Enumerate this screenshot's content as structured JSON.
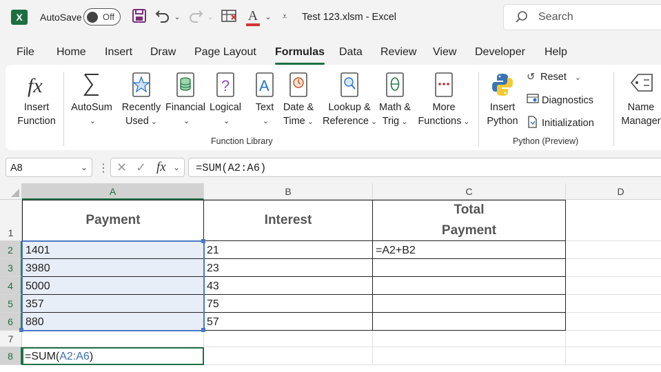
{
  "title_bar": {
    "app_logo": "X",
    "autosave_label": "AutoSave",
    "autosave_state": "Off",
    "document_title": "Test 123.xlsm  -  Excel",
    "search_placeholder": "Search"
  },
  "menu_tabs": [
    "File",
    "Home",
    "Insert",
    "Draw",
    "Page Layout",
    "Formulas",
    "Data",
    "Review",
    "View",
    "Developer",
    "Help"
  ],
  "active_tab": "Formulas",
  "ribbon": {
    "insert_function": [
      "Insert",
      "Function"
    ],
    "autosum": "AutoSum",
    "recently_used": [
      "Recently",
      "Used"
    ],
    "financial": "Financial",
    "logical": "Logical",
    "text": "Text",
    "date_time": [
      "Date &",
      "Time"
    ],
    "lookup_reference": [
      "Lookup &",
      "Reference"
    ],
    "math_trig": [
      "Math &",
      "Trig"
    ],
    "more_functions": [
      "More",
      "Functions"
    ],
    "group_function_library": "Function Library",
    "insert_python": [
      "Insert",
      "Python"
    ],
    "reset": "Reset",
    "diagnostics": "Diagnostics",
    "initialization": "Initialization",
    "group_python": "Python (Preview)",
    "name_manager": [
      "Name",
      "Manager"
    ]
  },
  "formula_bar": {
    "name_box": "A8",
    "fx_symbol": "fx",
    "formula": "=SUM(A2:A6)"
  },
  "grid": {
    "columns": [
      "A",
      "B",
      "C",
      "D"
    ],
    "rows": [
      "1",
      "2",
      "3",
      "4",
      "5",
      "6",
      "7",
      "8"
    ],
    "headers": {
      "a": "Payment",
      "b": "Interest",
      "c1": "Total",
      "c2": "Payment"
    },
    "payment": [
      "1401",
      "3980",
      "5000",
      "357",
      "880"
    ],
    "interest": [
      "21",
      "23",
      "43",
      "75",
      "57"
    ],
    "c2_formula": "=A2+B2",
    "a8": {
      "prefix": "=SUM(",
      "ref": "A2:A6",
      "suffix": ")"
    }
  },
  "colors": {
    "accent": "#1e7145",
    "range_fill": "#e8eef8",
    "ref_blue": "#3b6db3"
  }
}
